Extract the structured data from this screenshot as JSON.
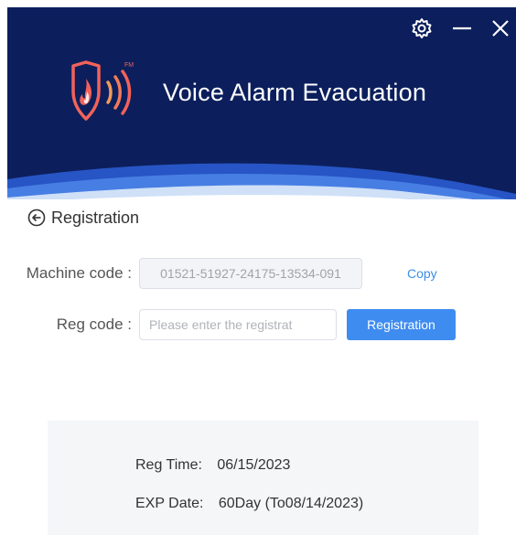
{
  "app": {
    "title": "Voice Alarm Evacuation",
    "logo_icon": "fire-shield-sound-icon",
    "logo_mark": "FM"
  },
  "window_controls": {
    "settings_icon": "gear-icon",
    "minimize_icon": "minimize-icon",
    "close_icon": "close-icon"
  },
  "colors": {
    "header_bg": "#0c1f5c",
    "accent_blue": "#3f8cf0",
    "logo_red": "#f2625a"
  },
  "registration": {
    "back_icon": "circle-arrow-left-icon",
    "title": "Registration",
    "machine_code_label": "Machine code :",
    "machine_code_value": "01521-51927-24175-13534-091",
    "copy_label": "Copy",
    "reg_code_label": "Reg code :",
    "reg_code_placeholder": "Please enter the registrat",
    "reg_code_value": "",
    "register_button": "Registration"
  },
  "info": {
    "reg_time_label": "Reg Time:",
    "reg_time_value": "06/15/2023",
    "exp_date_label": "EXP Date:",
    "exp_date_value": "60Day (To08/14/2023)"
  }
}
